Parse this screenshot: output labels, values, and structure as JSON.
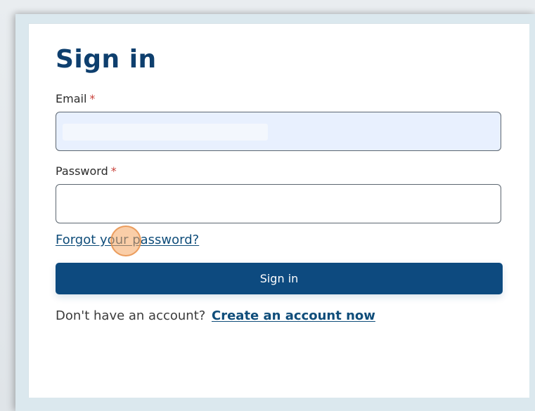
{
  "form": {
    "title": "Sign in",
    "email_label": "Email",
    "password_label": "Password",
    "required_marker": "*",
    "email_value": "",
    "password_value": "",
    "forgot_password_link": "Forgot your password?",
    "submit_label": "Sign in",
    "no_account_text": "Don't have an account?",
    "create_account_link": "Create an account now"
  },
  "colors": {
    "title": "#0e3f6e",
    "primary_button": "#0d4a7f",
    "link": "#0f4d7a",
    "required": "#c8413a",
    "email_autofill_bg": "#e8f0fe",
    "click_indicator": "#f6a660"
  }
}
